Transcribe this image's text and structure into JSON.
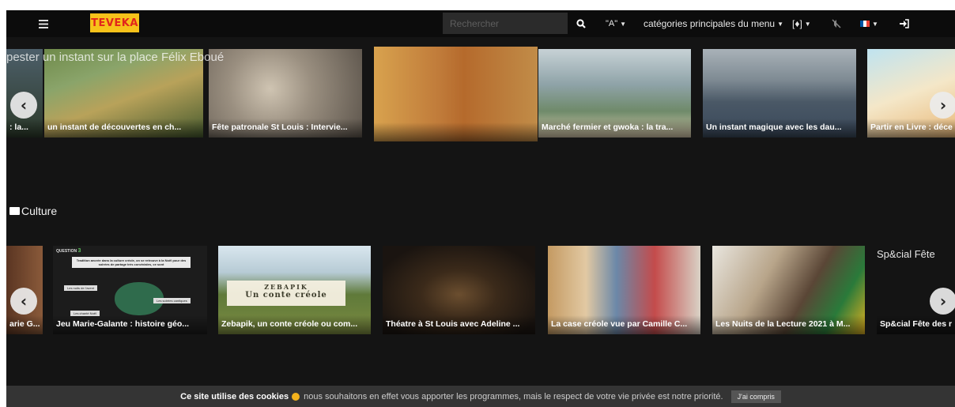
{
  "navbar": {
    "logo_text": "TEVEKA",
    "search_placeholder": "Rechercher",
    "a11y_label": "\"A\"",
    "categories_label": "catégories principales du menu",
    "icons": [
      "hamburger-icon",
      "search-icon",
      "accessibility-icon",
      "map-icon",
      "mute-icon",
      "flag-fr-icon",
      "sign-in-icon"
    ]
  },
  "row1": {
    "overlay_title": "pester un instant sur la place Félix Eboué",
    "cards": [
      {
        "caption": ": la..."
      },
      {
        "caption": "un instant de découvertes en ch..."
      },
      {
        "caption": "Fête patronale St Louis : Intervie..."
      },
      {
        "caption": ""
      },
      {
        "caption": "Marché fermier et gwoka : la tra..."
      },
      {
        "caption": "Un instant magique avec les dau..."
      },
      {
        "caption": "Partir en Livre : déce"
      }
    ]
  },
  "culture": {
    "title": "Culture",
    "cards": [
      {
        "caption": "arie G..."
      },
      {
        "caption": "Jeu Marie-Galante : histoire géo..."
      },
      {
        "caption": "Zebapik, un conte créole ou com..."
      },
      {
        "caption": "Théatre à St Louis avec Adeline ..."
      },
      {
        "caption": "La case créole vue par Camille C..."
      },
      {
        "caption": "Les Nuits de la Lecture 2021 à M..."
      },
      {
        "caption": "Sp&cial Fête des r"
      }
    ],
    "broken_image_alt": "Sp&cial Fête",
    "zebapik_title": "ZEBAPIK",
    "zebapik_subtitle": "Un conte créole",
    "quiz_question": "QUESTION",
    "quiz_number": "3",
    "quiz_text": "Tradition ancrée dans la culture créole, on se retrouve à la Noël pour des soirées de partage très conviviales, ce sont",
    "quiz_answers": [
      "Les nuits de l'avent",
      "Les soirées cantiques",
      "Les chanté Noël"
    ],
    "quiz_letters": [
      "A",
      "B",
      "C"
    ]
  },
  "cookie": {
    "bold": "Ce site utilise des cookies",
    "text": "nous souhaitons en effet vous apporter les programmes, mais le respect de votre vie privée est notre priorité.",
    "button": "J'ai compris"
  },
  "colors": {
    "accent_logo_bg": "#f7c21a",
    "accent_logo_text": "#e1261c",
    "background": "#141414"
  }
}
